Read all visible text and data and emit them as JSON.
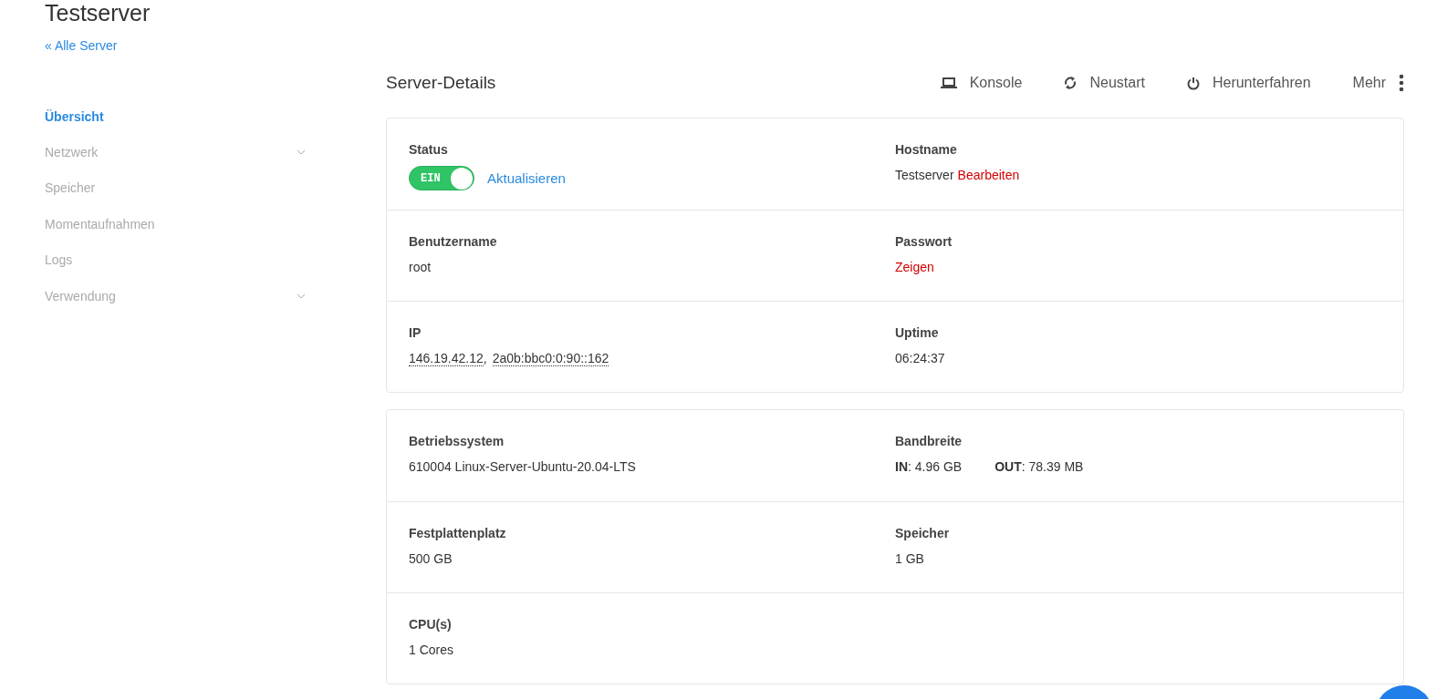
{
  "page": {
    "title": "Testserver",
    "back_link": "« Alle Server"
  },
  "sidebar": {
    "items": [
      {
        "label": "Übersicht",
        "selected": true,
        "expandable": false
      },
      {
        "label": "Netzwerk",
        "selected": false,
        "expandable": true
      },
      {
        "label": "Speicher",
        "selected": false,
        "expandable": false
      },
      {
        "label": "Momentaufnahmen",
        "selected": false,
        "expandable": false
      },
      {
        "label": "Logs",
        "selected": false,
        "expandable": false
      },
      {
        "label": "Verwendung",
        "selected": false,
        "expandable": true
      }
    ]
  },
  "header": {
    "title": "Server-Details",
    "actions": [
      {
        "kind": "console",
        "label": "Konsole"
      },
      {
        "kind": "restart",
        "label": "Neustart"
      },
      {
        "kind": "power",
        "label": "Herunterfahren"
      },
      {
        "kind": "more",
        "label": "Mehr"
      }
    ]
  },
  "cards": [
    {
      "rows": [
        [
          {
            "kind": "toggle",
            "label": "Status",
            "toggle": {
              "text": "EIN",
              "on": true
            },
            "link": "Aktualisieren"
          },
          {
            "kind": "text",
            "label": "Hostname",
            "value": "Testserver",
            "link": "Bearbeiten"
          }
        ],
        [
          {
            "kind": "text",
            "label": "Benutzername",
            "value": "root"
          },
          {
            "kind": "link",
            "label": "Passwort",
            "link": "Zeigen"
          }
        ],
        [
          {
            "kind": "addresses",
            "label": "IP",
            "addresses": [
              "146.19.42.12",
              "2a0b:bbc0:0:90::162"
            ],
            "separator": ","
          },
          {
            "kind": "text",
            "label": "Uptime",
            "value": "06:24:37"
          }
        ]
      ]
    },
    {
      "rows": [
        [
          {
            "kind": "text",
            "label": "Betriebssystem",
            "value": "610004 Linux-Server-Ubuntu-20.04-LTS"
          },
          {
            "kind": "pairs",
            "label": "Bandbreite",
            "parts": [
              "**IN**: 4.96 GB",
              "**OUT**: 78.39 MB"
            ]
          }
        ],
        [
          {
            "kind": "text",
            "label": "Festplattenplatz",
            "value": "500 GB"
          },
          {
            "kind": "text",
            "label": "Speicher",
            "value": "1 GB"
          }
        ],
        [
          {
            "kind": "text",
            "label": "CPU(s)",
            "value": "1 Cores"
          }
        ]
      ]
    }
  ]
}
